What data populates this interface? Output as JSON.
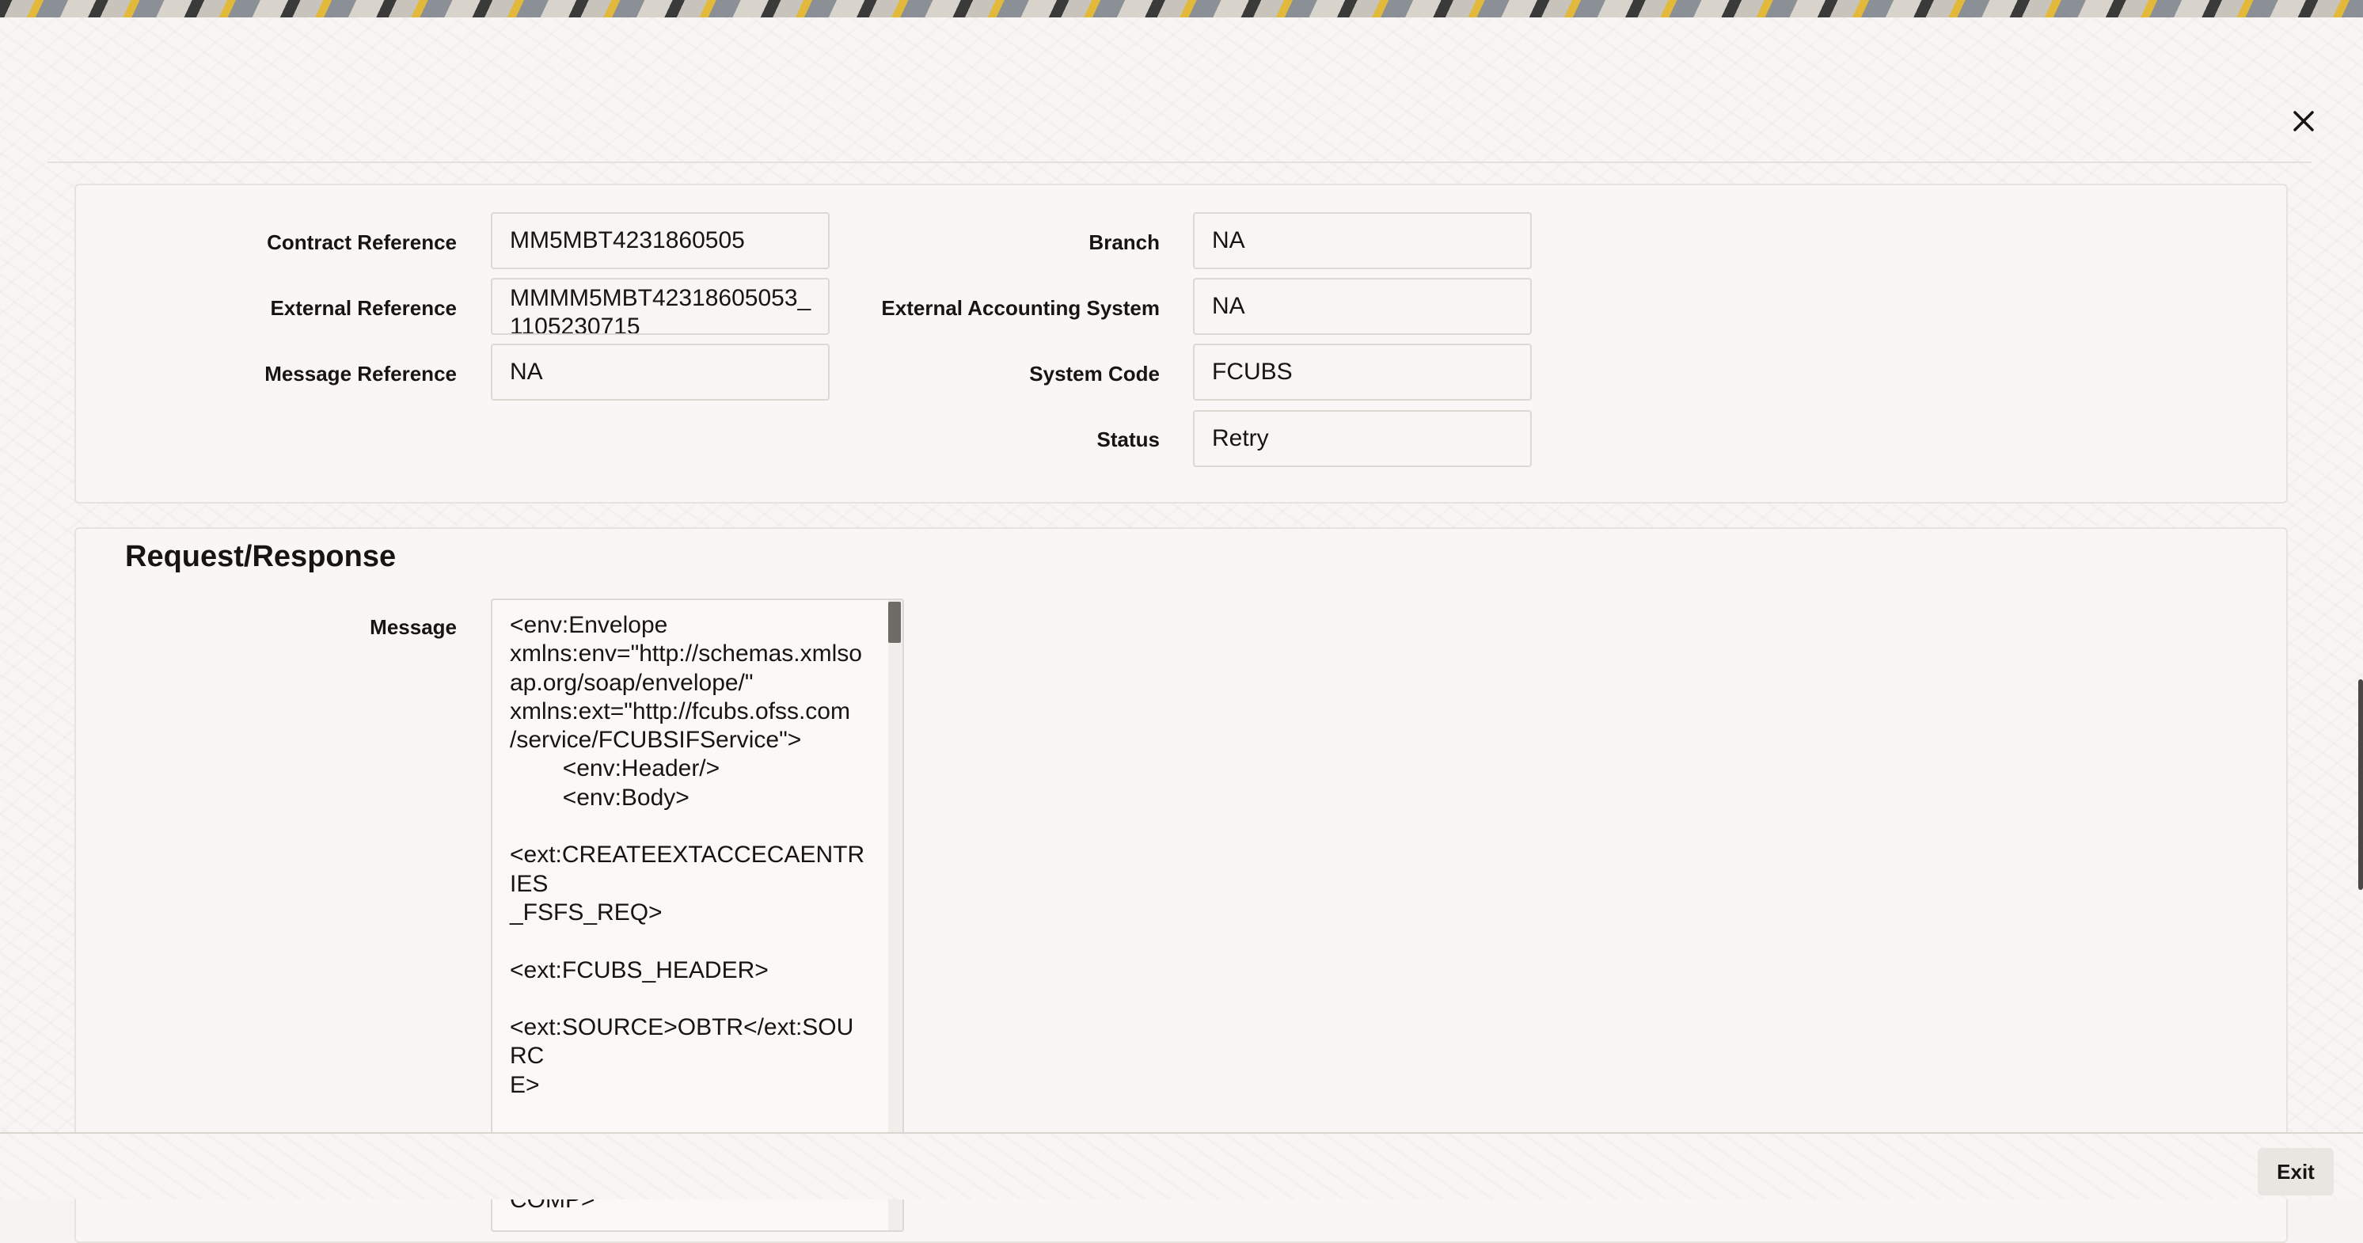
{
  "header": {
    "close_icon": "close-icon"
  },
  "details": {
    "contract_reference": {
      "label": "Contract Reference",
      "value": "MM5MBT4231860505"
    },
    "external_reference": {
      "label": "External Reference",
      "value": "MMMM5MBT42318605053_\n1105230715"
    },
    "message_reference": {
      "label": "Message Reference",
      "value": "NA"
    },
    "branch": {
      "label": "Branch",
      "value": "NA"
    },
    "external_accounting_system": {
      "label": "External Accounting System",
      "value": "NA"
    },
    "system_code": {
      "label": "System Code",
      "value": "FCUBS"
    },
    "status": {
      "label": "Status",
      "value": "Retry"
    }
  },
  "request_response": {
    "title": "Request/Response",
    "message_label": "Message",
    "message_text": "<env:Envelope\nxmlns:env=\"http://schemas.xmlso\nap.org/soap/envelope/\"\nxmlns:ext=\"http://fcubs.ofss.com\n/service/FCUBSIFService\">\n        <env:Header/>\n        <env:Body>\n\n<ext:CREATEEXTACCECAENTRIES\n_FSFS_REQ>\n\n<ext:FCUBS_HEADER>\n\n<ext:SOURCE>OBTR</ext:SOURC\nE>\n\n<ext:UBSCOMP>FCUBS</ext:UBS\nCOMP>"
  },
  "footer": {
    "exit_label": "Exit"
  }
}
